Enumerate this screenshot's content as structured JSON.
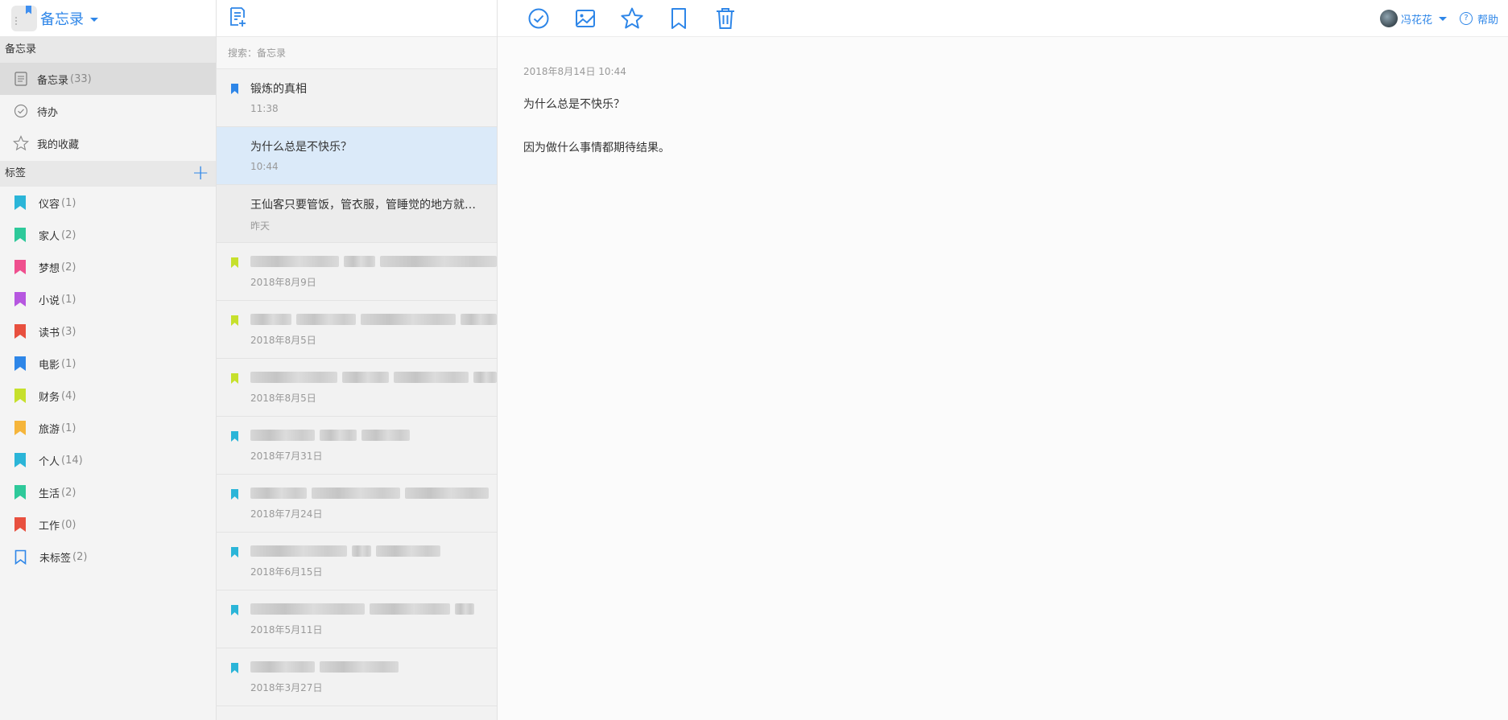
{
  "sidebar": {
    "app_title": "备忘录",
    "section_memo": "备忘录",
    "nav": [
      {
        "label": "备忘录",
        "count": "(33)",
        "icon": "note-icon"
      },
      {
        "label": "待办",
        "count": "",
        "icon": "check-circle-icon"
      },
      {
        "label": "我的收藏",
        "count": "",
        "icon": "star-icon"
      }
    ],
    "section_tags": "标签",
    "add_tag_icon": "plus-icon",
    "tags": [
      {
        "label": "仪容",
        "count": "(1)",
        "color": "#2bb5d8"
      },
      {
        "label": "家人",
        "count": "(2)",
        "color": "#2ec99a"
      },
      {
        "label": "梦想",
        "count": "(2)",
        "color": "#ef4f8e"
      },
      {
        "label": "小说",
        "count": "(1)",
        "color": "#b657e0"
      },
      {
        "label": "读书",
        "count": "(3)",
        "color": "#e8503f"
      },
      {
        "label": "电影",
        "count": "(1)",
        "color": "#2e86e8"
      },
      {
        "label": "财务",
        "count": "(4)",
        "color": "#c6e02c"
      },
      {
        "label": "旅游",
        "count": "(1)",
        "color": "#f5b53b"
      },
      {
        "label": "个人",
        "count": "(14)",
        "color": "#2bb5d8"
      },
      {
        "label": "生活",
        "count": "(2)",
        "color": "#2ec99a"
      },
      {
        "label": "工作",
        "count": "(0)",
        "color": "#e8503f"
      },
      {
        "label": "未标签",
        "count": "(2)",
        "color": "#2e86e8"
      }
    ]
  },
  "list": {
    "new_note_icon": "new-note-icon",
    "search_text": "搜索：备忘录",
    "notes": [
      {
        "title": "锻炼的真相",
        "date": "11:38",
        "flag": "#2e86e8",
        "blurred": false
      },
      {
        "title": "为什么总是不快乐？",
        "date": "10:44",
        "flag": "",
        "blurred": false
      },
      {
        "title": "王仙客只要管饭，管衣服，管睡觉的地方就足够了",
        "date": "昨天",
        "flag": "",
        "blurred": false
      },
      {
        "title": "",
        "date": "2018年8月9日",
        "flag": "#c6e02c",
        "blurred": true
      },
      {
        "title": "",
        "date": "2018年8月5日",
        "flag": "#c6e02c",
        "blurred": true
      },
      {
        "title": "",
        "date": "2018年8月5日",
        "flag": "#c6e02c",
        "blurred": true
      },
      {
        "title": "",
        "date": "2018年7月31日",
        "flag": "#2bb5d8",
        "blurred": true
      },
      {
        "title": "",
        "date": "2018年7月24日",
        "flag": "#2bb5d8",
        "blurred": true
      },
      {
        "title": "",
        "date": "2018年6月15日",
        "flag": "#2bb5d8",
        "blurred": true
      },
      {
        "title": "",
        "date": "2018年5月11日",
        "flag": "#2bb5d8",
        "blurred": true
      },
      {
        "title": "",
        "date": "2018年3月27日",
        "flag": "#2bb5d8",
        "blurred": true
      }
    ]
  },
  "toolbar": {
    "icons": [
      "check-circle-icon",
      "image-icon",
      "star-icon",
      "bookmark-icon",
      "trash-icon"
    ],
    "accent": "#2e86e8"
  },
  "user": {
    "name": "冯花花",
    "help_label": "帮助"
  },
  "note": {
    "timestamp": "2018年8月14日 10:44",
    "line1": "为什么总是不快乐？",
    "line2": "因为做什么事情都期待结果。"
  }
}
